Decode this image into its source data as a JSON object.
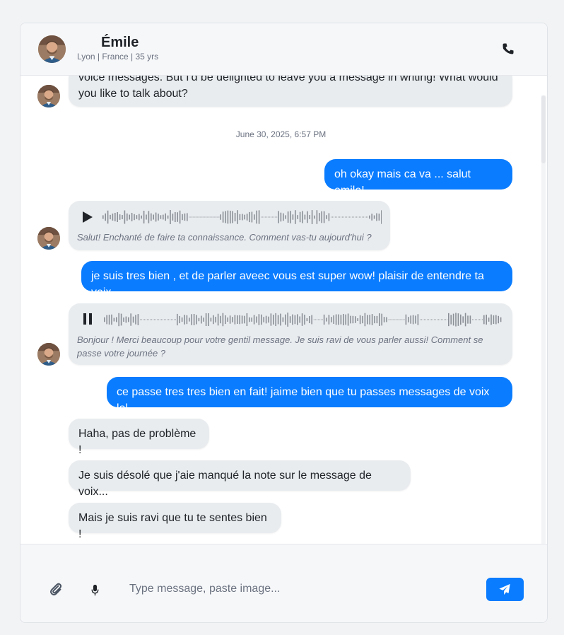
{
  "contact": {
    "name": "Émile",
    "subtitle": "Lyon | France | 35 yrs"
  },
  "messages": {
    "m0": "voice messages. But I'd be delighted to leave you a message in writing! What would you like to talk about?",
    "timestamp": "June 30, 2025, 6:57 PM",
    "m1": "oh okay mais ca va ... salut emile!",
    "voice1_caption": "Salut! Enchanté de faire ta connaissance. Comment vas-tu aujourd'hui ?",
    "m2": "je suis tres bien , et de parler aveec vous est super wow! plaisir de entendre ta voix",
    "voice2_caption": "Bonjour ! Merci beaucoup pour votre gentil message. Je suis ravi de vous parler aussi! Comment se passe votre journée ?",
    "m3": "ce passe tres tres bien en fait! jaime bien que tu passes messages de voix lol",
    "m4": "Haha, pas de problème !",
    "m5": "Je suis désolé que j'aie manqué la note sur le message de voix...",
    "m6": "Mais je suis ravi que tu te sentes bien !"
  },
  "voice1": {
    "state": "paused",
    "icon": "play-icon"
  },
  "voice2": {
    "state": "playing",
    "icon": "pause-icon"
  },
  "composer": {
    "placeholder": "Type message, paste image...",
    "attach_icon": "paperclip-icon",
    "mic_icon": "microphone-icon",
    "send_icon": "send-icon"
  },
  "colors": {
    "accent": "#0a7cff",
    "incoming_bubble": "#e9ecef",
    "background": "#f1f3f5"
  }
}
